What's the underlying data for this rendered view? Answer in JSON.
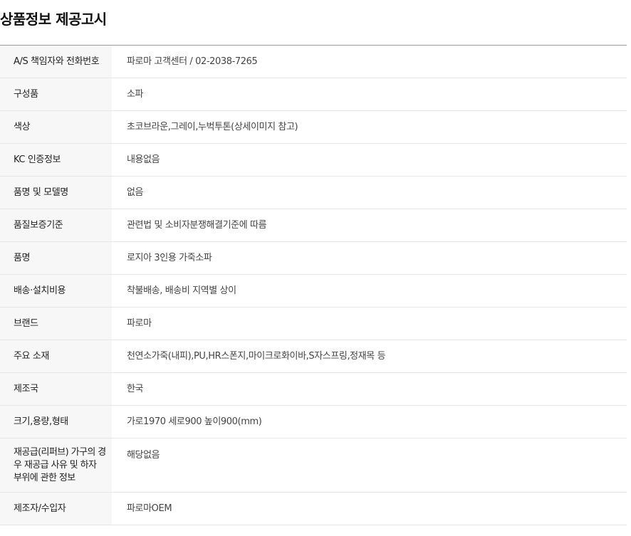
{
  "title": "상품정보 제공고시",
  "rows": [
    {
      "label": "A/S 책임자와 전화번호",
      "value": "파로마 고객센터 / 02-2038-7265"
    },
    {
      "label": "구성품",
      "value": "소파"
    },
    {
      "label": "색상",
      "value": "초코브라운,그레이,누벅투톤(상세이미지 참고)"
    },
    {
      "label": "KC 인증정보",
      "value": "내용없음"
    },
    {
      "label": "품명 및 모델명",
      "value": "없음"
    },
    {
      "label": "품질보증기준",
      "value": "관련법 및 소비자분쟁해결기준에 따름"
    },
    {
      "label": "품명",
      "value": "로지아 3인용 가죽소파"
    },
    {
      "label": "배송·설치비용",
      "value": "착불배송, 배송비 지역별 상이"
    },
    {
      "label": "브랜드",
      "value": "파로마"
    },
    {
      "label": "주요 소재",
      "value": "천연소가죽(내피),PU,HR스폰지,마이크로화이바,S자스프링,정재목 등"
    },
    {
      "label": "제조국",
      "value": "한국"
    },
    {
      "label": "크기,용량,형태",
      "value": "가로1970 세로900 높이900(mm)"
    },
    {
      "label": "재공급(리퍼브) 가구의 경우 재공급 사유 및 하자 부위에 관한 정보",
      "value": "해당없음"
    },
    {
      "label": "제조자/수입자",
      "value": "파로마OEM"
    }
  ]
}
